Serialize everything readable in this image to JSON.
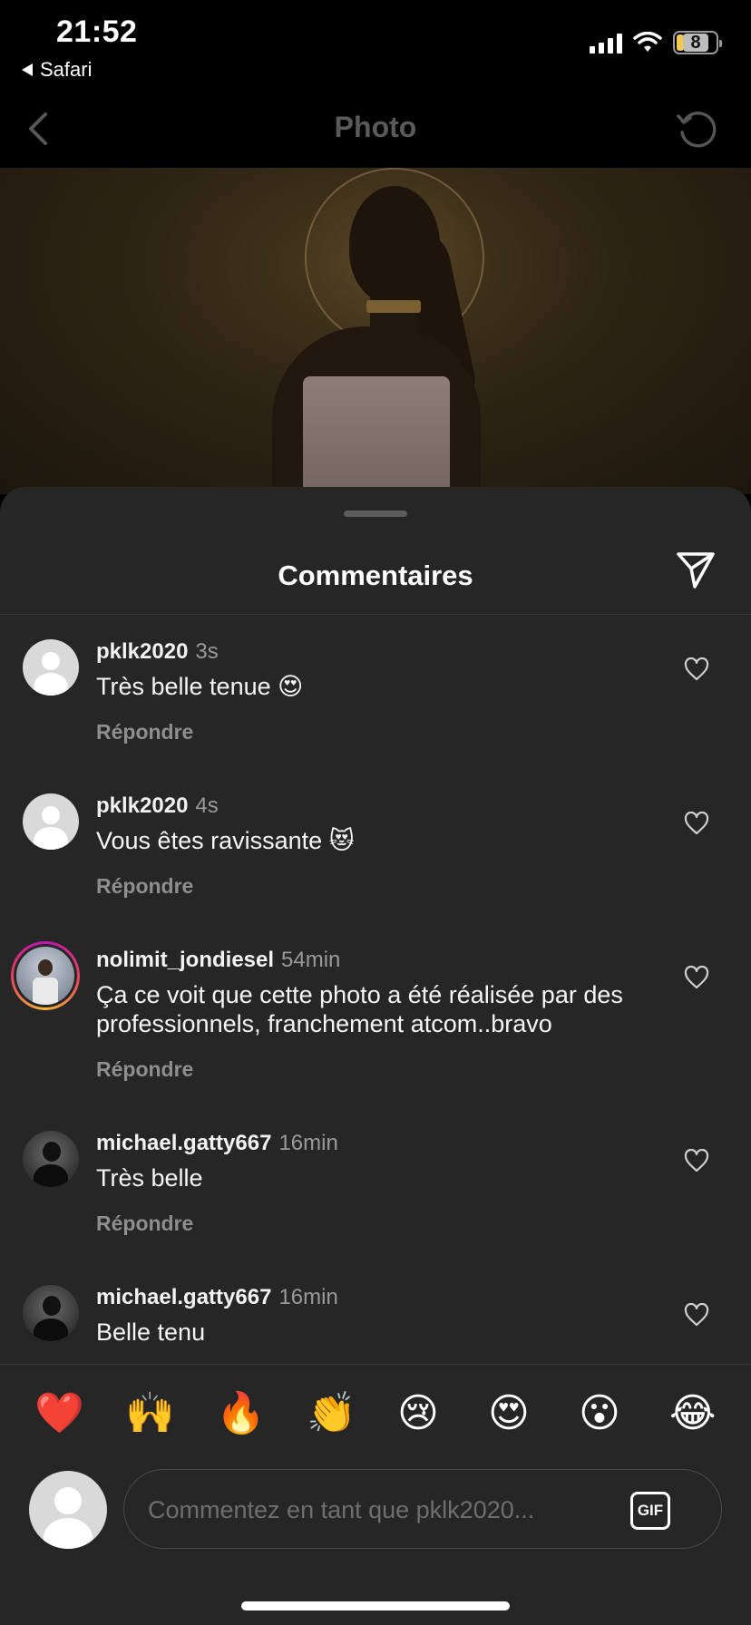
{
  "status_bar": {
    "time": "21:52",
    "back_app": "Safari",
    "battery": "8"
  },
  "header": {
    "title": "Photo"
  },
  "comments_sheet": {
    "title": "Commentaires",
    "comments": [
      {
        "user": "pklk2020",
        "time": "3s",
        "text": "Très belle tenue 😍",
        "reply": "Répondre"
      },
      {
        "user": "pklk2020",
        "time": "4s",
        "text": "Vous êtes ravissante 😻",
        "reply": "Répondre"
      },
      {
        "user": "nolimit_jondiesel",
        "time": "54min",
        "text": "Ça ce voit que cette photo a été réalisée par des professionnels, franchement atcom..bravo",
        "reply": "Répondre"
      },
      {
        "user": "michael.gatty667",
        "time": "16min",
        "text": "Très belle",
        "reply": "Répondre"
      },
      {
        "user": "michael.gatty667",
        "time": "16min",
        "text": "Belle tenu"
      }
    ]
  },
  "emoji_bar": [
    "❤️",
    "🙌",
    "🔥",
    "👏",
    "😢",
    "😍",
    "😮",
    "😂"
  ],
  "composer": {
    "placeholder": "Commentez en tant que pklk2020...",
    "gif_label": "GIF"
  },
  "colors": {
    "sheet_bg": "#262626",
    "secondary_text": "#8e8e8e",
    "ring_gradient": [
      "#c013b6",
      "#e4405f",
      "#f7b733"
    ]
  }
}
